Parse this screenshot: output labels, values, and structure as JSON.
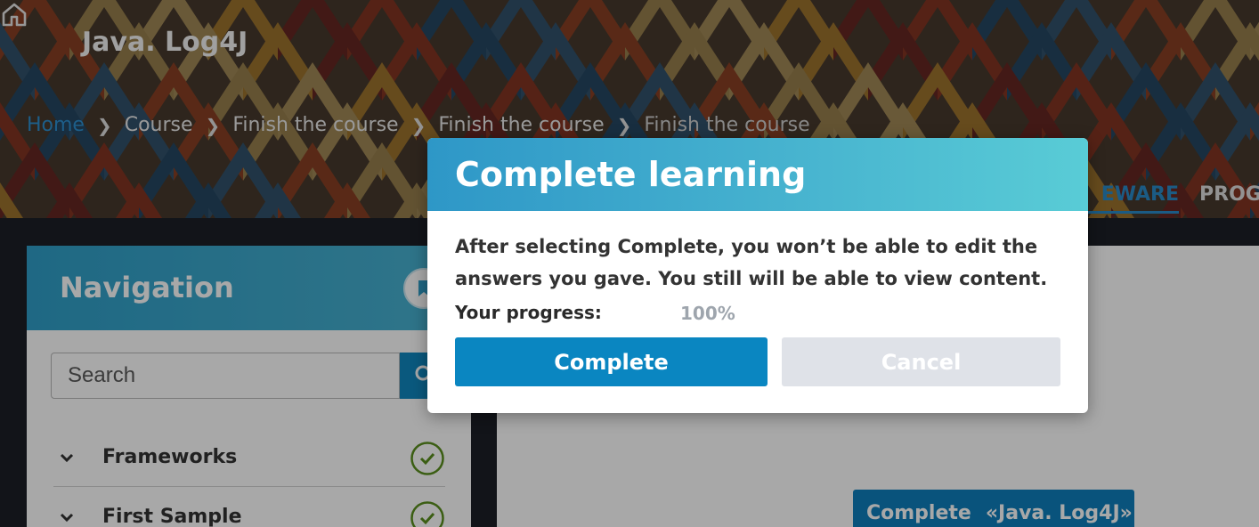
{
  "header": {
    "course_title": "Java. Log4J",
    "home_icon": "home-icon"
  },
  "breadcrumb": [
    "Home",
    "Course",
    "Finish the course",
    "Finish the course",
    "Finish the course"
  ],
  "tabs": {
    "active_partial": "EWARE",
    "progress_partial": "PROGR"
  },
  "navigation": {
    "title": "Navigation",
    "search_placeholder": "Search",
    "items": [
      {
        "label": "Frameworks",
        "completed": true
      },
      {
        "label": "First Sample",
        "completed": true
      }
    ]
  },
  "content": {
    "complete_label": "Complete",
    "course_name": "«Java. Log4J»"
  },
  "modal": {
    "title": "Complete learning",
    "message": "After selecting Complete, you won’t be able to edit the answers you gave. You still will be able to view content.",
    "progress_label": "Your progress:",
    "progress_value": "100%",
    "complete_button": "Complete",
    "cancel_button": "Cancel"
  },
  "colors": {
    "accent": "#0a86c1",
    "check_green": "#5a8f1e"
  }
}
